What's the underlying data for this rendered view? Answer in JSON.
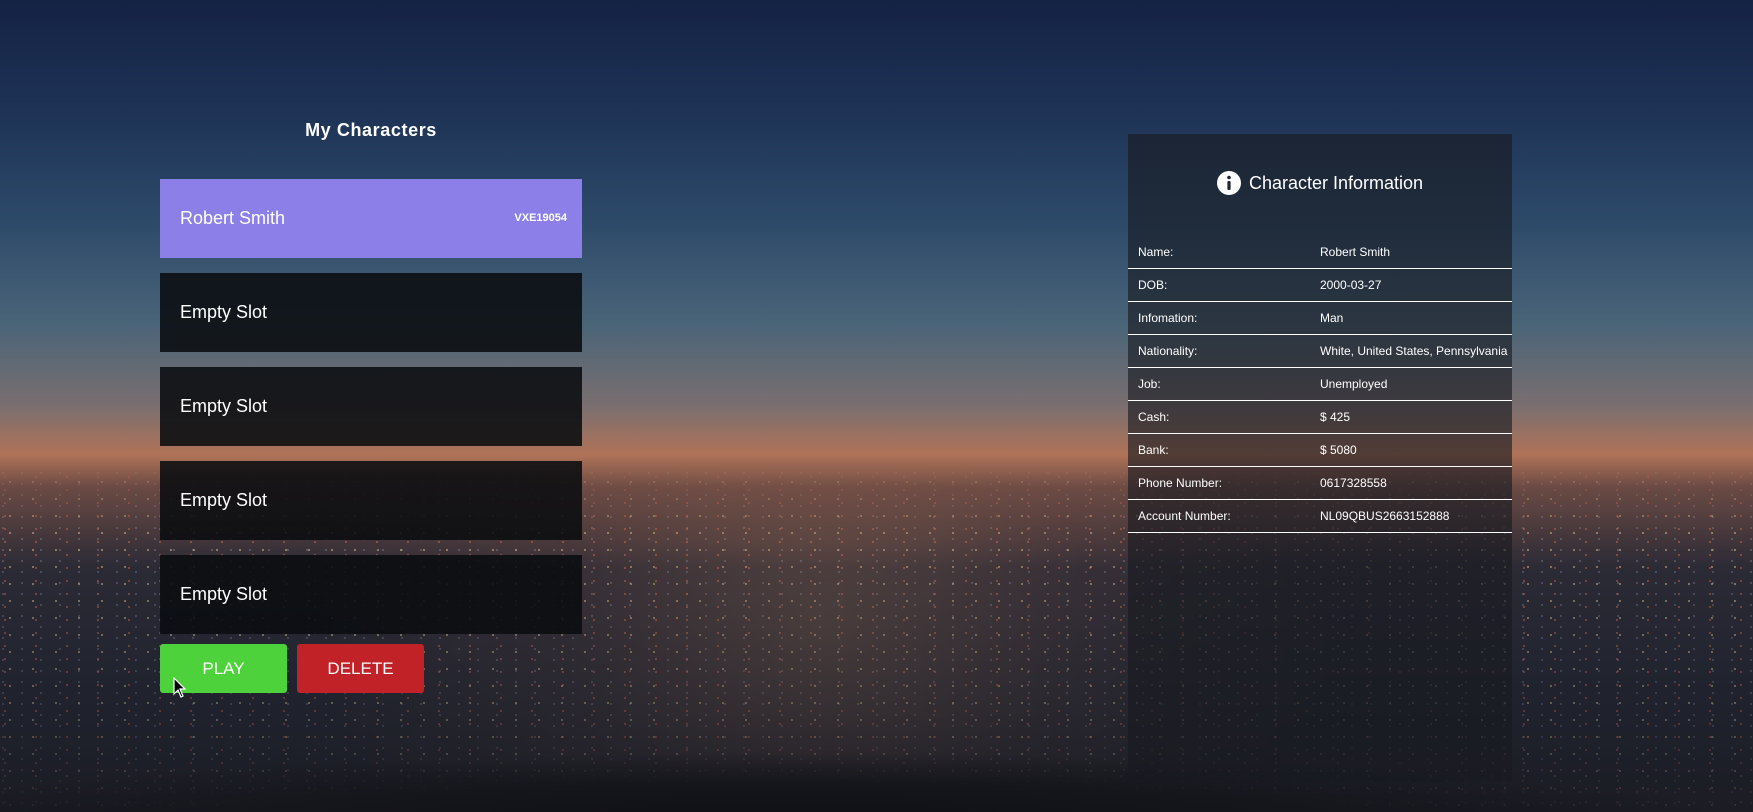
{
  "characters": {
    "title": "My Characters",
    "slots": [
      {
        "name": "Robert Smith",
        "id": "VXE19054",
        "selected": true
      },
      {
        "name": "Empty Slot",
        "id": ""
      },
      {
        "name": "Empty Slot",
        "id": ""
      },
      {
        "name": "Empty Slot",
        "id": ""
      },
      {
        "name": "Empty Slot",
        "id": ""
      }
    ]
  },
  "actions": {
    "play_label": "PLAY",
    "delete_label": "DELETE"
  },
  "info": {
    "title": "Character Information",
    "icon": "info-icon",
    "rows": [
      {
        "label": "Name:",
        "value": "Robert Smith"
      },
      {
        "label": "DOB:",
        "value": "2000-03-27"
      },
      {
        "label": "Infomation:",
        "value": "Man"
      },
      {
        "label": "Nationality:",
        "value": "White, United States, Pennsylvania"
      },
      {
        "label": "Job:",
        "value": "Unemployed"
      },
      {
        "label": "Cash:",
        "value": "$ 425"
      },
      {
        "label": "Bank:",
        "value": "$ 5080"
      },
      {
        "label": "Phone Number:",
        "value": "0617328558"
      },
      {
        "label": "Account Number:",
        "value": "NL09QBUS2663152888"
      }
    ]
  },
  "colors": {
    "selected_slot": "#8c80e8",
    "play": "#4dd23b",
    "delete": "#c02228"
  }
}
